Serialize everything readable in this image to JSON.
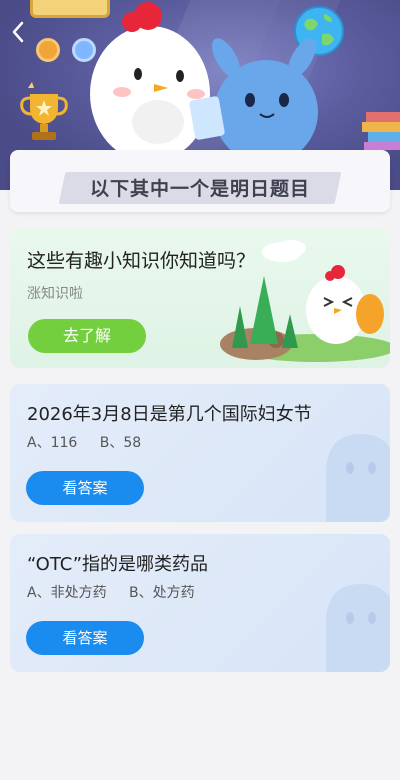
{
  "header": {
    "back_icon": "chevron-left-icon",
    "title": "以下其中一个是明日题目"
  },
  "promo": {
    "title": "这些有趣小知识你知道吗？",
    "subtitle": "涨知识啦",
    "button_label": "去了解",
    "button_color": "#74cf3e"
  },
  "questions": [
    {
      "title": "2026年3月8日是第几个国际妇女节",
      "options": [
        "A、116",
        "B、58"
      ],
      "button_label": "看答案"
    },
    {
      "title": "“OTC”指的是哪类药品",
      "options": [
        "A、非处方药",
        "B、处方药"
      ],
      "button_label": "看答案"
    }
  ],
  "colors": {
    "accent_blue": "#1a8cf0",
    "hero_bg": "#4a4b87",
    "page_bg": "#f3f3f5"
  }
}
